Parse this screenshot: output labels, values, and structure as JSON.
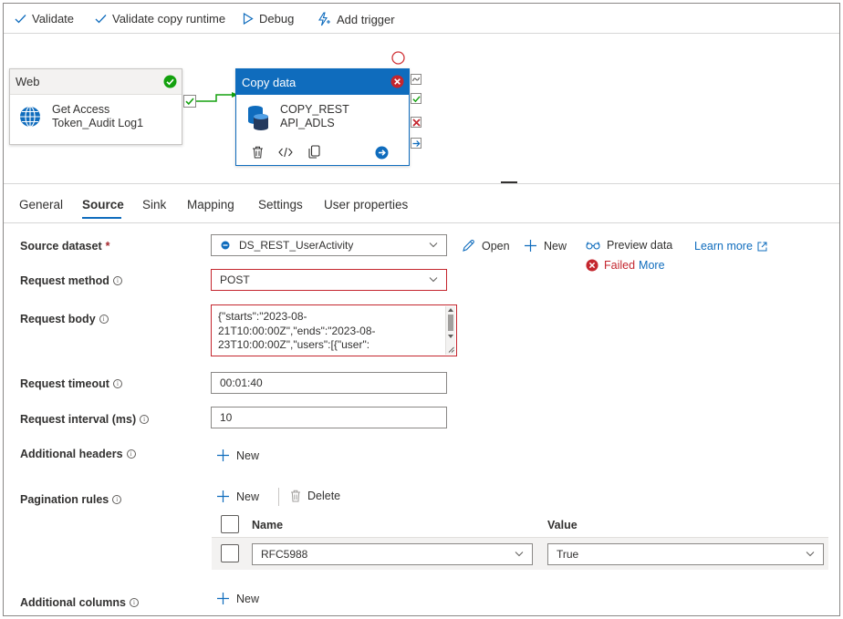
{
  "toolbar": {
    "validate": "Validate",
    "validate_copy_runtime": "Validate copy runtime",
    "debug": "Debug",
    "add_trigger": "Add trigger"
  },
  "canvas": {
    "web_activity": {
      "type": "Web",
      "name_line1": "Get Access",
      "name_line2": "Token_Audit Log1"
    },
    "copy_activity": {
      "type": "Copy data",
      "name_line1": "COPY_REST",
      "name_line2": "API_ADLS"
    }
  },
  "tabs": [
    {
      "label": "General",
      "active": false
    },
    {
      "label": "Source",
      "active": true
    },
    {
      "label": "Sink",
      "active": false
    },
    {
      "label": "Mapping",
      "active": false
    },
    {
      "label": "Settings",
      "active": false
    },
    {
      "label": "User properties",
      "active": false
    }
  ],
  "source": {
    "dataset_label": "Source dataset",
    "required_mark": "*",
    "dataset_value": "DS_REST_UserActivity",
    "open": "Open",
    "new": "New",
    "preview_data": "Preview data",
    "learn_more": "Learn more",
    "failed": "Failed",
    "more": "More",
    "method_label": "Request method",
    "method_value": "POST",
    "body_label": "Request body",
    "body_line1": "{\"starts\":\"2023-08-",
    "body_line2": "21T10:00:00Z\",\"ends\":\"2023-08-",
    "body_line3": "23T10:00:00Z\",\"users\":[{\"user\":",
    "timeout_label": "Request timeout",
    "timeout_value": "00:01:40",
    "interval_label": "Request interval (ms)",
    "interval_value": "10",
    "headers_label": "Additional headers",
    "headers_new": "New",
    "pagination_label": "Pagination rules",
    "pagination_new": "New",
    "pagination_delete": "Delete",
    "col_name": "Name",
    "col_value": "Value",
    "rule_name": "RFC5988",
    "rule_value": "True",
    "columns_label": "Additional columns",
    "columns_new": "New"
  },
  "colors": {
    "accent": "#0f6cbd",
    "node_header_active": "#0f6cbd",
    "success": "#13a10e",
    "error": "#c4262e"
  }
}
